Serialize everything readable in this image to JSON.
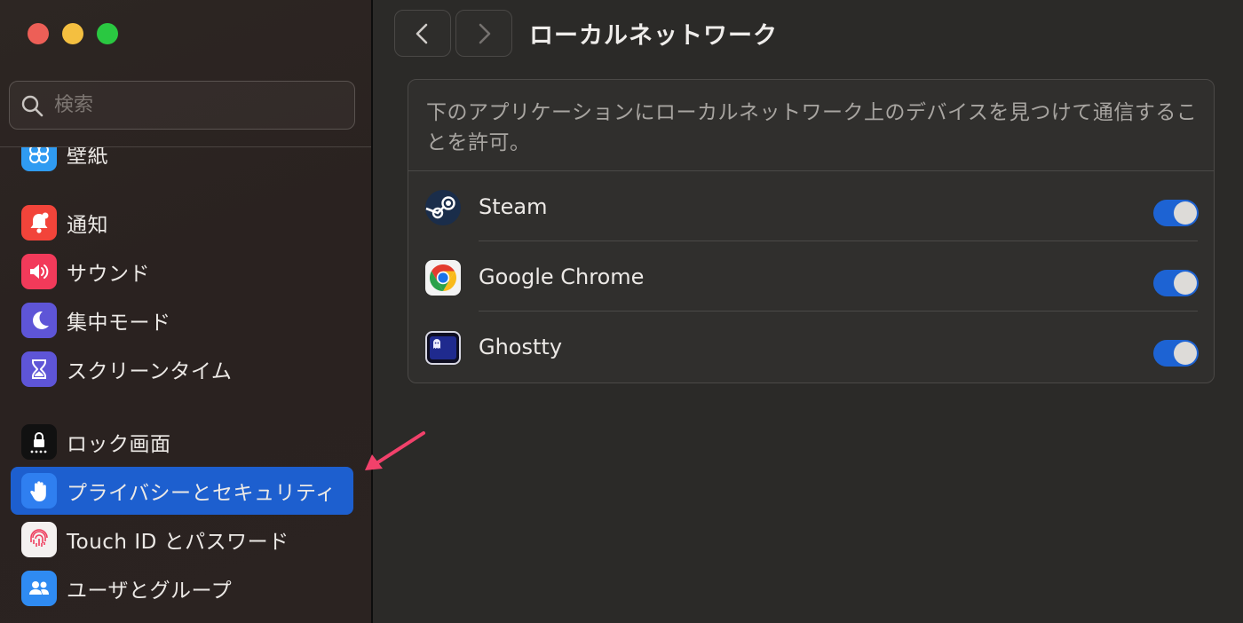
{
  "window": {
    "buttons": [
      "close",
      "minimize",
      "maximize"
    ]
  },
  "sidebar": {
    "search": {
      "placeholder": "検索",
      "icon": "search-icon"
    },
    "items": [
      {
        "label": "壁紙",
        "icon": "wallpaper-icon",
        "color": "#2f9bf2"
      },
      {
        "label": "通知",
        "icon": "bell-icon",
        "color": "#f2443a"
      },
      {
        "label": "サウンド",
        "icon": "speaker-icon",
        "color": "#f23a5a"
      },
      {
        "label": "集中モード",
        "icon": "moon-icon",
        "color": "#5e55d7"
      },
      {
        "label": "スクリーンタイム",
        "icon": "hourglass-icon",
        "color": "#5e55d7"
      },
      {
        "label": "ロック画面",
        "icon": "lock-icon",
        "color": "#111111"
      },
      {
        "label": "プライバシーとセキュリティ",
        "icon": "hand-icon",
        "color": "#2f7ff0",
        "selected": true
      },
      {
        "label": "Touch ID とパスワード",
        "icon": "fingerprint-icon",
        "color": "#f4f1f0"
      },
      {
        "label": "ユーザとグループ",
        "icon": "users-icon",
        "color": "#2f8bf2"
      }
    ]
  },
  "main": {
    "title": "ローカルネットワーク",
    "description": "下のアプリケーションにローカルネットワーク上のデバイスを見つけて通信することを許可。",
    "apps": [
      {
        "name": "Steam",
        "icon": "steam-icon",
        "enabled": true
      },
      {
        "name": "Google Chrome",
        "icon": "chrome-icon",
        "enabled": true
      },
      {
        "name": "Ghostty",
        "icon": "ghostty-icon",
        "enabled": true
      }
    ]
  },
  "colors": {
    "accent": "#1d5fcf",
    "toggle_on": "#1d63d3",
    "annotation_arrow": "#f2416b"
  }
}
